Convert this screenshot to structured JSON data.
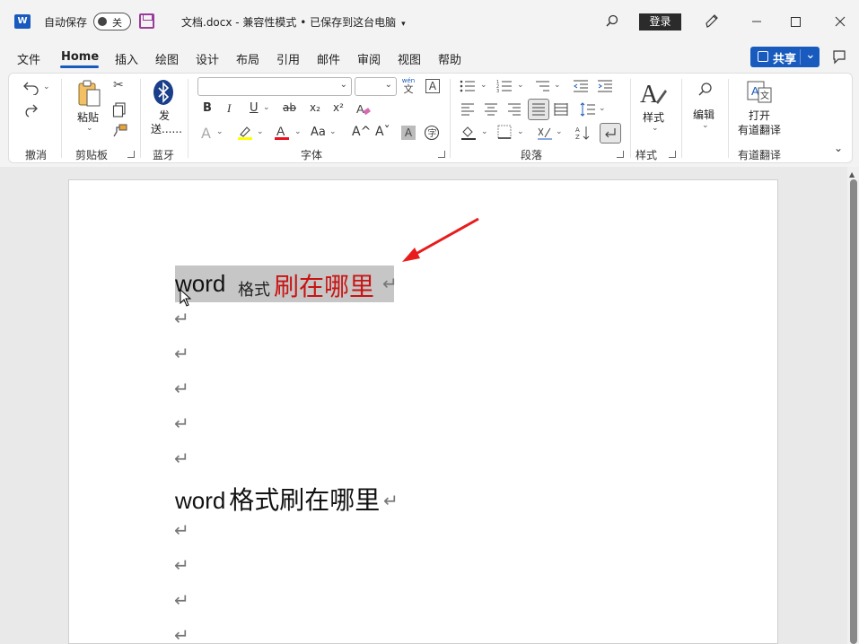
{
  "titlebar": {
    "app_icon_letter": "W",
    "autosave_label": "自动保存",
    "autosave_state": "关",
    "doc_title": "文档.docx  -  兼容性模式 • 已保存到这台电脑",
    "login_label": "登录"
  },
  "menu": {
    "items": [
      "文件",
      "Home",
      "插入",
      "绘图",
      "设计",
      "布局",
      "引用",
      "邮件",
      "审阅",
      "视图",
      "帮助"
    ],
    "active": "Home",
    "share_label": "共享"
  },
  "ribbon": {
    "groups": {
      "undo": "撤消",
      "clipboard": "剪贴板",
      "bluetooth": "蓝牙",
      "font": "字体",
      "paragraph": "段落",
      "styles": "样式",
      "youdao": "有道翻译"
    },
    "paste_label": "粘贴",
    "send_label": "发送......",
    "styles_label": "样式",
    "edit_label": "编辑",
    "open_label": "打开",
    "youdao_label": "有道翻译",
    "font_name": "",
    "font_size": "",
    "font_buttons": [
      "B",
      "I",
      "U",
      "ab",
      "x₂",
      "x²"
    ],
    "wen_label": "wén",
    "wen_char": "文",
    "grow_font": "A^",
    "shrink_font": "Aˇ",
    "case_label": "Aa",
    "highlight_color": "#ffff00",
    "font_color": "#e81123"
  },
  "document": {
    "line1_word": "word",
    "line1_fmt": "格式",
    "line1_red": "刷在哪里",
    "line2_word": "word",
    "line2_rest": "格式刷在哪里",
    "para_mark": "↵",
    "highlight_color": "#c6c6c6",
    "red_text_color": "#c81414",
    "annotation_arrow_color": "#e81c1c"
  }
}
